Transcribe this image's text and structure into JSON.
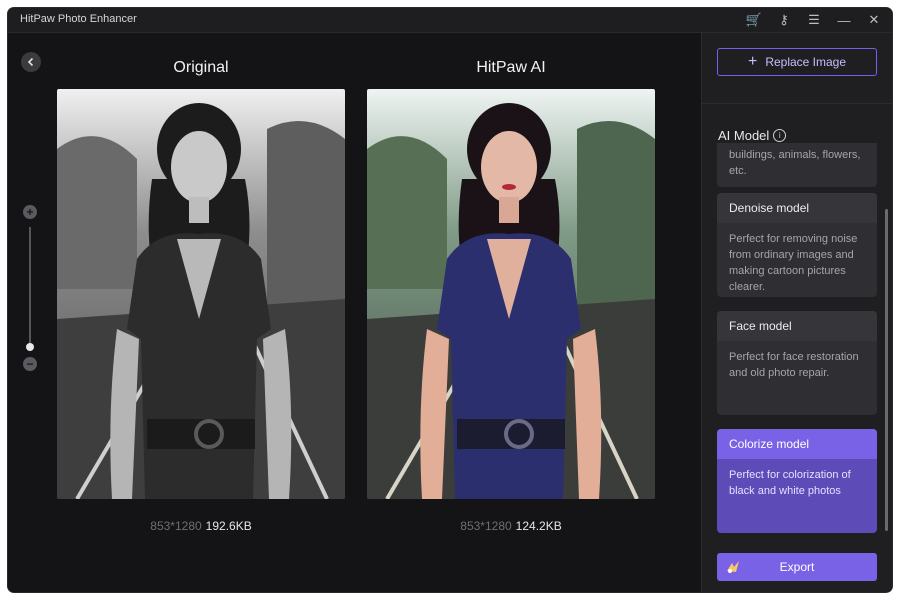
{
  "app": {
    "title": "HitPaw Photo Enhancer"
  },
  "window_controls": [
    {
      "name": "cart-icon",
      "glyph": "🛒"
    },
    {
      "name": "key-icon",
      "glyph": "⚷"
    },
    {
      "name": "menu-icon",
      "glyph": "☰"
    },
    {
      "name": "minimize-icon",
      "glyph": "—"
    },
    {
      "name": "close-icon",
      "glyph": "✕"
    }
  ],
  "images": {
    "original": {
      "title": "Original",
      "dimensions": "853*1280",
      "size": "192.6KB"
    },
    "enhanced": {
      "title": "HitPaw AI",
      "dimensions": "853*1280",
      "size": "124.2KB"
    }
  },
  "zoom": {
    "plus": "+",
    "minus": "−",
    "level": 0.05
  },
  "sidebar": {
    "replace_label": "Replace Image",
    "ai_model_label": "AI Model",
    "info_glyph": "i",
    "models": [
      {
        "title": "",
        "desc": "buildings, animals, flowers, etc.",
        "selected": false
      },
      {
        "title": "Denoise model",
        "desc": "Perfect for removing noise from ordinary images and making cartoon pictures clearer.",
        "selected": false
      },
      {
        "title": "Face model",
        "desc": "Perfect for face restoration and old photo repair.",
        "selected": false
      },
      {
        "title": "Colorize model",
        "desc": "Perfect for colorization of black and white photos",
        "selected": true
      }
    ],
    "export_label": "Export"
  },
  "colors": {
    "accent": "#7a62e6",
    "panel": "#1f1f22",
    "background": "#141417"
  }
}
